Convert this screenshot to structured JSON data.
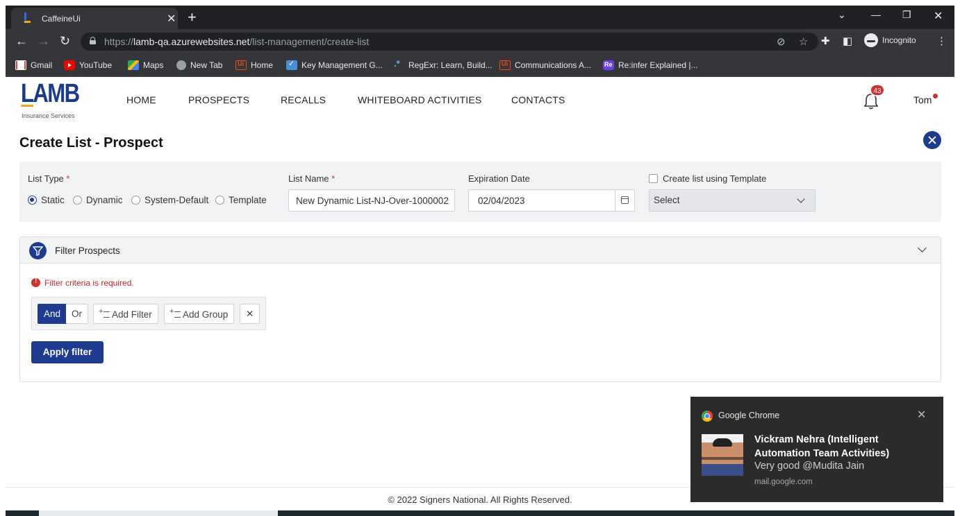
{
  "browser": {
    "tab_title": "CaffeineUi",
    "url_scheme": "https://",
    "url_host": "lamb-qa.azurewebsites.net",
    "url_path": "/list-management/create-list",
    "profile_label": "Incognito",
    "bookmarks": [
      {
        "label": "Gmail",
        "icon": "gmail-icon"
      },
      {
        "label": "YouTube",
        "icon": "youtube-icon"
      },
      {
        "label": "Maps",
        "icon": "maps-icon"
      },
      {
        "label": "New Tab",
        "icon": "globe-icon"
      },
      {
        "label": "Home",
        "icon": "uipath-icon"
      },
      {
        "label": "Key Management G...",
        "icon": "checkbox-icon"
      },
      {
        "label": "RegExr: Learn, Build...",
        "icon": "regex-icon"
      },
      {
        "label": "Communications A...",
        "icon": "uipath-icon"
      },
      {
        "label": "Re:infer Explained |...",
        "icon": "reinfer-icon"
      }
    ]
  },
  "header": {
    "logo_text": "LAMB",
    "logo_subtext": "Insurance Services",
    "nav": [
      "HOME",
      "PROSPECTS",
      "RECALLS",
      "WHITEBOARD ACTIVITIES",
      "CONTACTS"
    ],
    "notification_count": "43",
    "user_name": "Tom"
  },
  "page": {
    "title": "Create List - Prospect",
    "list_type_label": "List Type",
    "required_mark": "*",
    "list_types": [
      "Static",
      "Dynamic",
      "System-Default",
      "Template"
    ],
    "selected_list_type": "Static",
    "list_name_label": "List Name",
    "list_name_value": "New Dynamic List-NJ-Over-1000002",
    "expiration_label": "Expiration Date",
    "expiration_value": "02/04/2023",
    "template_checkbox_label": "Create list using Template",
    "template_select_value": "Select"
  },
  "filter": {
    "title": "Filter Prospects",
    "error": "Filter criteria is required.",
    "and_label": "And",
    "or_label": "Or",
    "add_filter_label": "Add Filter",
    "add_group_label": "Add Group",
    "remove_label": "✕",
    "apply_label": "Apply filter"
  },
  "footer": {
    "text": "© 2022 Signers National. All Rights Reserved."
  },
  "notification": {
    "app": "Google Chrome",
    "title": "Vickram Nehra (Intelligent Automation Team Activities)",
    "message": "Very good @Mudita Jain",
    "source": "mail.google.com"
  },
  "colors": {
    "brand_blue": "#1d3b8f",
    "error_red": "#d32f2f",
    "accent_orange": "#f5a623"
  }
}
